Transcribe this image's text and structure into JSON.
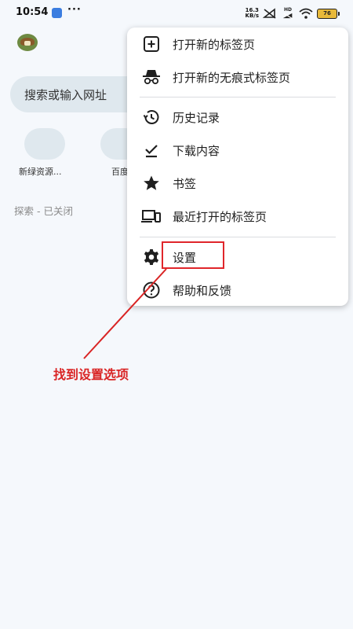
{
  "status_bar": {
    "time": "10:54",
    "more": "···",
    "speed_value": "16.3",
    "speed_unit": "KB/s",
    "signal_tag": "HD",
    "battery": "76"
  },
  "home": {
    "search_placeholder": "搜索或输入网址",
    "tiles": [
      {
        "label": "新绿资源..."
      },
      {
        "label": "百度"
      }
    ],
    "discover_status": "探索 - 已关闭"
  },
  "menu": {
    "items": [
      {
        "label": "打开新的标签页",
        "icon": "add-box-icon"
      },
      {
        "label": "打开新的无痕式标签页",
        "icon": "incognito-icon"
      },
      {
        "label": "历史记录",
        "icon": "history-icon"
      },
      {
        "label": "下载内容",
        "icon": "download-done-icon"
      },
      {
        "label": "书签",
        "icon": "star-icon"
      },
      {
        "label": "最近打开的标签页",
        "icon": "devices-icon"
      },
      {
        "label": "设置",
        "icon": "gear-icon"
      },
      {
        "label": "帮助和反馈",
        "icon": "help-icon"
      }
    ]
  },
  "annotation": {
    "text": "找到设置选项",
    "color": "#d92424"
  }
}
